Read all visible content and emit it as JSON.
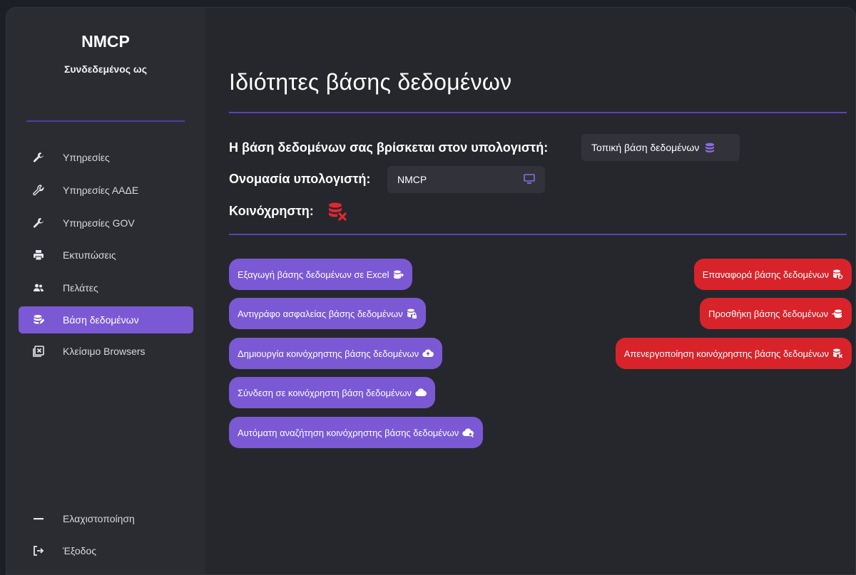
{
  "app": {
    "brand": "NMCP",
    "logged_in_as": "Συνδεδεμένος ως"
  },
  "sidebar": {
    "items": [
      {
        "label": "Υπηρεσίες",
        "icon": "wrench-icon"
      },
      {
        "label": "Υπηρεσίες ΑΑΔΕ",
        "icon": "wrench-icon"
      },
      {
        "label": "Υπηρεσίες GOV",
        "icon": "wrench-icon"
      },
      {
        "label": "Εκτυπώσεις",
        "icon": "printer-icon"
      },
      {
        "label": "Πελάτες",
        "icon": "users-icon"
      },
      {
        "label": "Βάση δεδομένων",
        "icon": "database-icon",
        "active": true
      },
      {
        "label": "Κλείσιμο Browsers",
        "icon": "close-window-icon"
      }
    ],
    "bottom": [
      {
        "label": "Ελαχιστοποίηση",
        "icon": "minimize-icon"
      },
      {
        "label": "Έξοδος",
        "icon": "exit-icon"
      }
    ]
  },
  "main": {
    "title": "Ιδιότητες βάσης δεδομένων",
    "location_label": "Η βάση δεδομένων σας βρίσκεται στον υπολογιστή:",
    "location_value": "Τοπική βάση δεδομένων",
    "computer_label": "Ονομασία υπολογιστή:",
    "computer_value": "NMCP",
    "shared_label": "Κοινόχρηστη:"
  },
  "actions_left": [
    {
      "label": "Εξαγωγή βάσης δεδομένων σε Excel",
      "icon": "db-export-icon"
    },
    {
      "label": "Αντιγράφο ασφαλείας βάσης δεδομένων",
      "icon": "db-lock-icon"
    },
    {
      "label": "Δημιουργία κοινόχρηστης βάσης δεδομένων",
      "icon": "cloud-upload-icon"
    },
    {
      "label": "Σύνδεση σε κοινόχρηστη βάση δεδομένων",
      "icon": "cloud-icon"
    },
    {
      "label": "Αυτόματη αναζήτηση κοινόχρηστης βάσης δεδομένων",
      "icon": "cloud-search-icon"
    }
  ],
  "actions_right": [
    {
      "label": "Επαναφορά βάσης δεδομένων",
      "icon": "db-restore-icon"
    },
    {
      "label": "Προσθήκη βάσης δεδομένων",
      "icon": "db-import-icon"
    },
    {
      "label": "Απενεργοποίηση κοινόχρηστης βάσης δεδομένων",
      "icon": "db-remove-icon"
    }
  ],
  "colors": {
    "accent": "#7b59d4",
    "danger": "#d8232a",
    "sidebar": "#2b2c31",
    "content": "#26272c"
  }
}
